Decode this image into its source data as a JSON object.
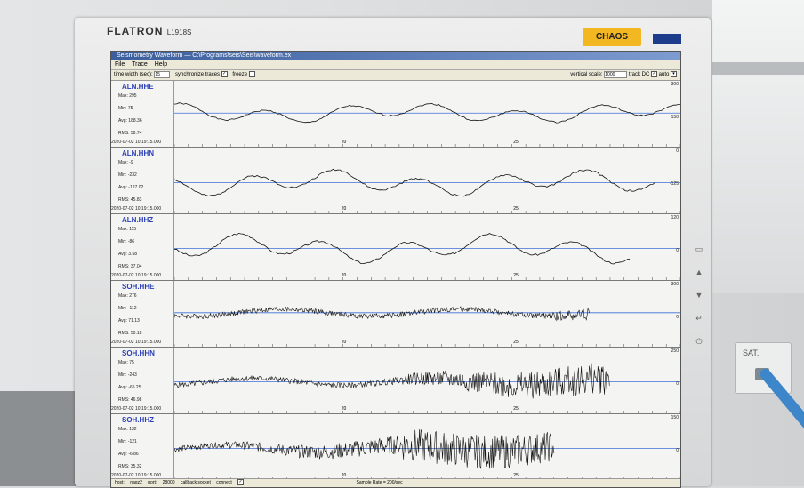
{
  "monitor": {
    "brand": "FLATRON",
    "model": "L1918S",
    "sticker": "CHAOS"
  },
  "room": {
    "socket_label": "SAT."
  },
  "app": {
    "title": "Seismometry Waveform — C:\\Programs\\seis\\Seis\\waveform.ex",
    "menu": [
      "File",
      "Trace",
      "Help"
    ],
    "toolbar": {
      "time_width_label": "time width (sec):",
      "time_width_value": "15",
      "sync_label": "synchronize traces",
      "sync_checked": "✓",
      "freeze_label": "freeze",
      "vertical_scale_label": "vertical scale:",
      "vertical_scale_value": "1000",
      "track_dc_label": "track DC",
      "track_dc_checked": "✓",
      "auto_label": "auto"
    },
    "ticks": [
      "20",
      "25"
    ],
    "traces": [
      {
        "station": "ALN.HHE",
        "max": "Max: 295",
        "min": "Min: 75",
        "avg": "Avg: 188.36",
        "rms": "RMS: 58.74",
        "time": "2020-07-02 10:19:15.000",
        "top": "300",
        "mid": "150",
        "color": "#111111",
        "kind": "smooth",
        "seed": 1,
        "amp": 0.35,
        "offset": -0.1,
        "end": 1.0
      },
      {
        "station": "ALN.HHN",
        "max": "Max: -9",
        "min": "Min: -232",
        "avg": "Avg: -127.02",
        "rms": "RMS: 45.83",
        "time": "2020-07-02 10:19:15.000",
        "top": "0",
        "mid": "-125",
        "color": "#111111",
        "kind": "smooth",
        "seed": 2,
        "amp": 0.45,
        "offset": 0.05,
        "end": 0.95
      },
      {
        "station": "ALN.HHZ",
        "max": "Max: 115",
        "min": "Min: -86",
        "avg": "Avg: 3.58",
        "rms": "RMS: 37.04",
        "time": "2020-07-02 10:19:15.000",
        "top": "120",
        "mid": "0",
        "color": "#111111",
        "kind": "smooth",
        "seed": 3,
        "amp": 0.5,
        "offset": 0.0,
        "end": 0.9
      },
      {
        "station": "SOH.HHE",
        "max": "Max: 276",
        "min": "Min: -112",
        "avg": "Avg: 71.13",
        "rms": "RMS: 50.18",
        "time": "2020-07-02 10:19:15.000",
        "top": "300",
        "mid": "0",
        "color": "#111111",
        "kind": "noisy",
        "seed": 4,
        "amp": 0.35,
        "offset": -0.12,
        "end": 0.82
      },
      {
        "station": "SOH.HHN",
        "max": "Max: 75",
        "min": "Min: -243",
        "avg": "Avg: -65.25",
        "rms": "RMS: 46.98",
        "time": "2020-07-02 10:19:15.000",
        "top": "250",
        "mid": "0",
        "color": "#111111",
        "kind": "noisy",
        "seed": 5,
        "amp": 0.38,
        "offset": 0.0,
        "end": 0.86
      },
      {
        "station": "SOH.HHZ",
        "max": "Max: 132",
        "min": "Min: -121",
        "avg": "Avg: -6.86",
        "rms": "RMS: 35.32",
        "time": "2020-07-02 10:19:15.000",
        "top": "150",
        "mid": "0",
        "color": "#111111",
        "kind": "noisy",
        "seed": 6,
        "amp": 0.4,
        "offset": 0.0,
        "end": 0.75
      }
    ],
    "status": {
      "host_label": "host:",
      "host": "nagz2",
      "port_label": "port:",
      "port": "28000",
      "callback_label": "callback socket",
      "connect_label": "connect",
      "connect_checked": "✓",
      "rate": "Sample Rate = 200/sec"
    },
    "colors": {
      "baseline": "#3f6fd8",
      "station": "#2b3fb7"
    }
  }
}
